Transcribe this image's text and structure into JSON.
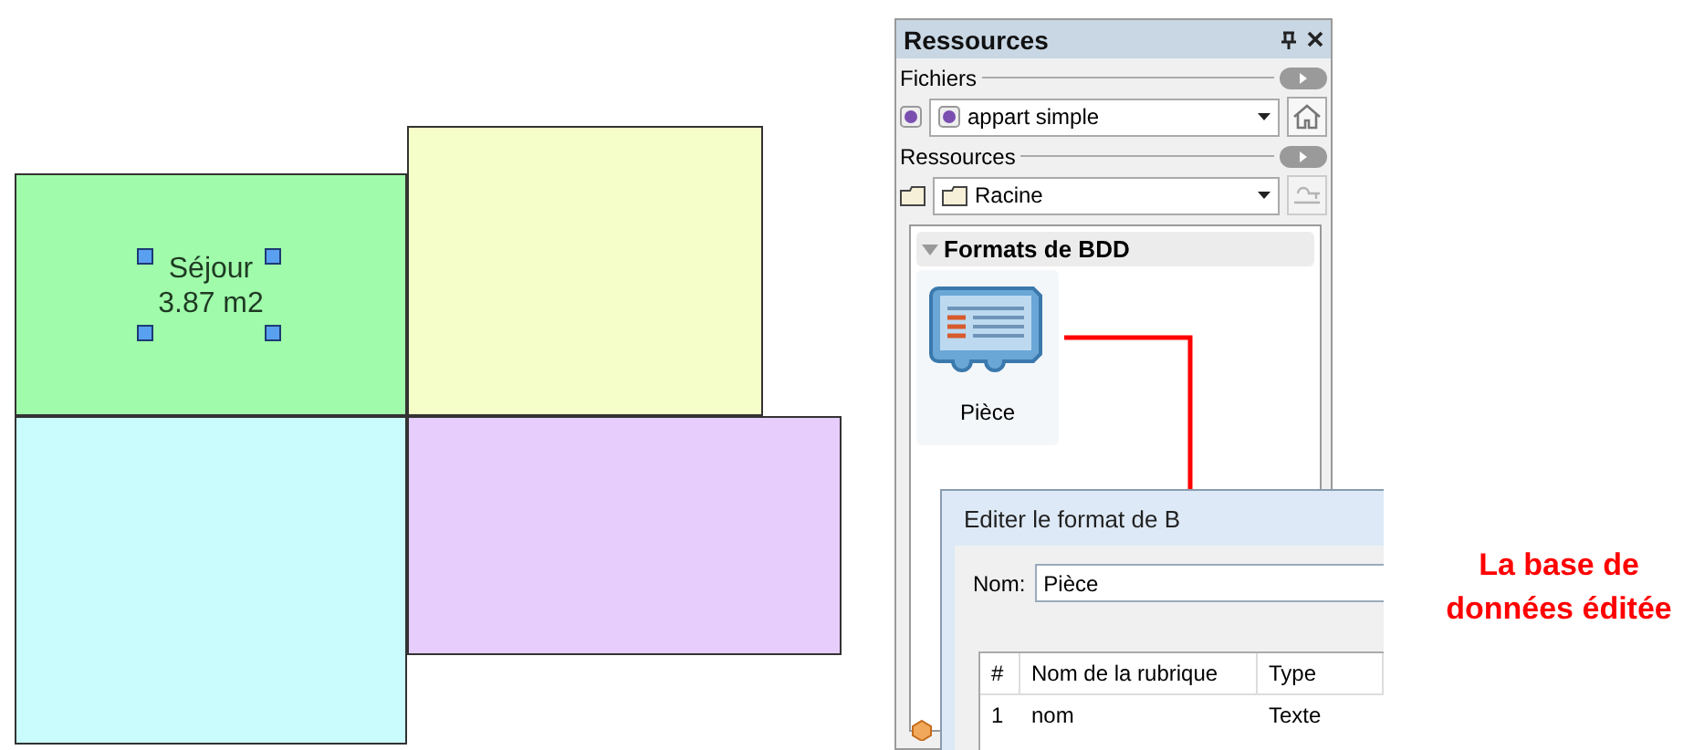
{
  "canvas": {
    "rooms": [
      {
        "color": "#a0fcaa",
        "selected": true,
        "label": "Séjour",
        "area": "3.87 m2"
      },
      {
        "color": "#f5fdc9",
        "selected": false
      },
      {
        "color": "#cafcfd",
        "selected": false
      },
      {
        "color": "#e6cdfc",
        "selected": false
      }
    ]
  },
  "panel": {
    "title": "Ressources",
    "files": {
      "label": "Fichiers",
      "value": "appart simple"
    },
    "resources": {
      "label": "Ressources",
      "value": "Racine"
    },
    "group": {
      "title": "Formats de BDD",
      "expanded": true,
      "items": [
        {
          "label": "Pièce",
          "selected": false
        }
      ]
    }
  },
  "dialog": {
    "title": "Editer le format de B",
    "name_label": "Nom:",
    "name_value": "Pièce",
    "table": {
      "columns": [
        "#",
        "Nom de la rubrique",
        "Type"
      ],
      "rows": [
        [
          "1",
          "nom",
          "Texte"
        ]
      ]
    }
  },
  "annotation": "La base de données éditée"
}
